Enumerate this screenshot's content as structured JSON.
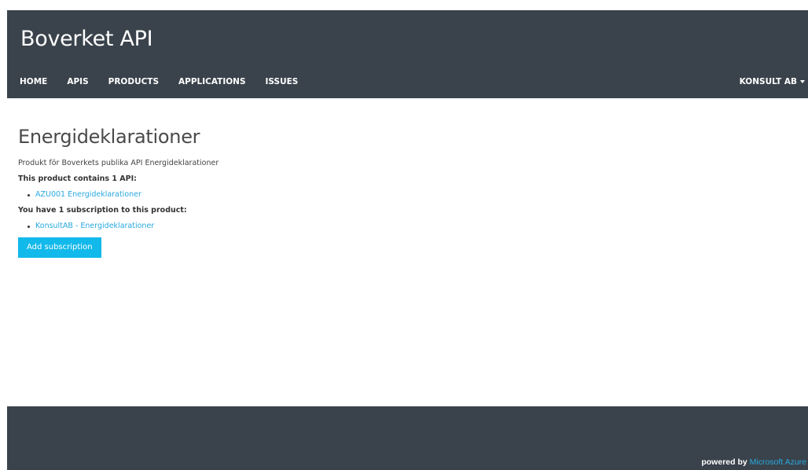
{
  "header": {
    "site_title": "Boverket API",
    "nav": [
      {
        "label": "HOME"
      },
      {
        "label": "APIS"
      },
      {
        "label": "PRODUCTS"
      },
      {
        "label": "APPLICATIONS"
      },
      {
        "label": "ISSUES"
      }
    ],
    "user_menu_label": "KONSULT AB"
  },
  "main": {
    "product_title": "Energideklarationer",
    "product_description": "Produkt för Boverkets publika API Energideklarationer",
    "apis_heading": "This product contains 1 API:",
    "apis": [
      {
        "label": "AZU001 Energideklarationer"
      }
    ],
    "subscriptions_heading": "You have 1 subscription to this product:",
    "subscriptions": [
      {
        "label": "KonsultAB - Energideklarationer"
      }
    ],
    "add_subscription_label": "Add subscription"
  },
  "footer": {
    "powered_prefix": "powered by",
    "powered_link": "Microsoft Azure"
  },
  "colors": {
    "header_bg": "#3a434b",
    "accent": "#12b9eb",
    "link": "#2aa8e0"
  }
}
